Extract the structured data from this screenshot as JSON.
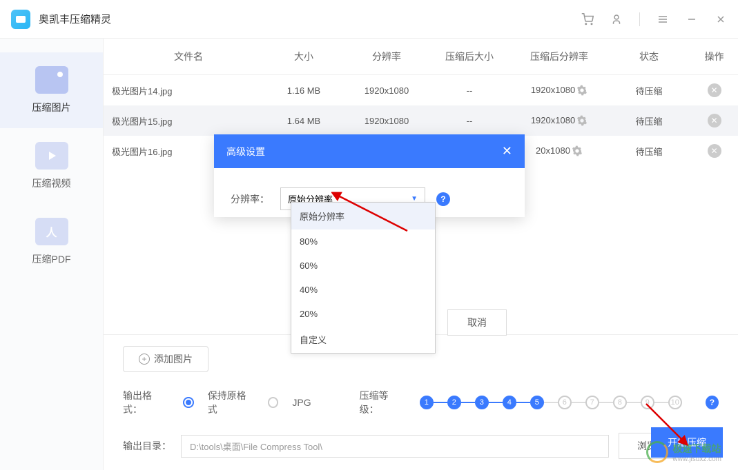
{
  "title": "奥凯丰压缩精灵",
  "sidebar": {
    "items": [
      {
        "label": "压缩图片"
      },
      {
        "label": "压缩视频"
      },
      {
        "label": "压缩PDF"
      }
    ]
  },
  "table": {
    "headers": {
      "name": "文件名",
      "size": "大小",
      "resolution": "分辨率",
      "compressed_size": "压缩后大小",
      "compressed_res": "压缩后分辨率",
      "status": "状态",
      "action": "操作"
    },
    "rows": [
      {
        "name": "极光图片14.jpg",
        "size": "1.16 MB",
        "res": "1920x1080",
        "csize": "--",
        "cres": "1920x1080",
        "status": "待压缩"
      },
      {
        "name": "极光图片15.jpg",
        "size": "1.64 MB",
        "res": "1920x1080",
        "csize": "--",
        "cres": "1920x1080",
        "status": "待压缩"
      },
      {
        "name": "极光图片16.jpg",
        "size": "",
        "res": "",
        "csize": "",
        "cres": "20x1080",
        "status": "待压缩"
      }
    ]
  },
  "bottom": {
    "add_label": "添加图片",
    "format_label": "输出格式：",
    "format_opt1": "保持原格式",
    "format_opt2": "JPG",
    "level_label": "压缩等级：",
    "output_label": "输出目录：",
    "output_path": "D:\\tools\\桌面\\File Compress Tool\\",
    "browse_label": "浏览",
    "start_label": "开始压缩"
  },
  "modal": {
    "title": "高级设置",
    "res_label": "分辨率：",
    "selected": "原始分辨率",
    "options": [
      "原始分辨率",
      "80%",
      "60%",
      "40%",
      "20%",
      "自定义"
    ],
    "cancel": "取消"
  },
  "watermark": {
    "text": "极速下载站",
    "sub": "www.jisuxz.com"
  }
}
